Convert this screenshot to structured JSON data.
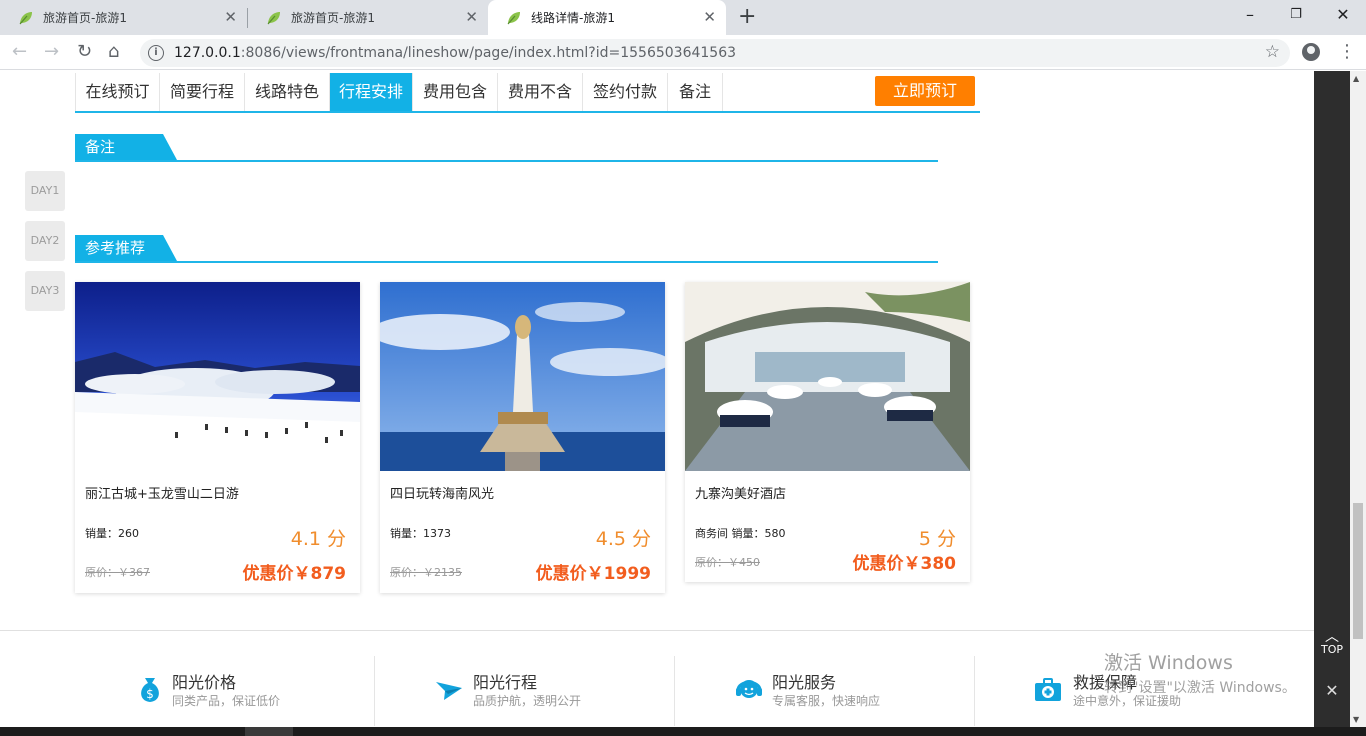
{
  "browser": {
    "tabs": [
      {
        "title": "旅游首页-旅游1"
      },
      {
        "title": "旅游首页-旅游1"
      },
      {
        "title": "线路详情-旅游1"
      }
    ],
    "url_host": "127.0.0.1",
    "url_rest": ":8086/views/frontmana/lineshow/page/index.html?id=1556503641563"
  },
  "subnav": {
    "items": [
      "在线预订",
      "简要行程",
      "线路特色",
      "行程安排",
      "费用包含",
      "费用不含",
      "签约付款",
      "备注"
    ],
    "active_index": 3,
    "book_label": "立即预订"
  },
  "days": [
    "DAY1",
    "DAY2",
    "DAY3"
  ],
  "sections": {
    "notes_title": "备注",
    "recommend_title": "参考推荐"
  },
  "cards": [
    {
      "name": "丽江古城+玉龙雪山二日游",
      "sales": "销量：260",
      "score": "4.1 分",
      "orig": "原价：￥367",
      "deal": "优惠价￥879"
    },
    {
      "name": "四日玩转海南风光",
      "sales": "销量：1373",
      "score": "4.5 分",
      "orig": "原价：￥2135",
      "deal": "优惠价￥1999"
    },
    {
      "name": "九寨沟美好酒店",
      "sales": "商务间 销量：580",
      "score": "5 分",
      "orig": "原价：￥450",
      "deal": "优惠价￥380"
    }
  ],
  "features": [
    {
      "title": "阳光价格",
      "sub": "同类产品，保证低价"
    },
    {
      "title": "阳光行程",
      "sub": "品质护航，透明公开"
    },
    {
      "title": "阳光服务",
      "sub": "专属客服，快速响应"
    },
    {
      "title": "救援保障",
      "sub": "途中意外，保证援助"
    }
  ],
  "sidebar_right": {
    "top_label": "TOP"
  },
  "watermark": {
    "line1": "激活 Windows",
    "line2": "转到\"设置\"以激活 Windows。"
  },
  "colors": {
    "accent": "#12b1e6",
    "book": "#ff7f00",
    "score": "#f08d2d",
    "deal": "#f25d1e"
  }
}
